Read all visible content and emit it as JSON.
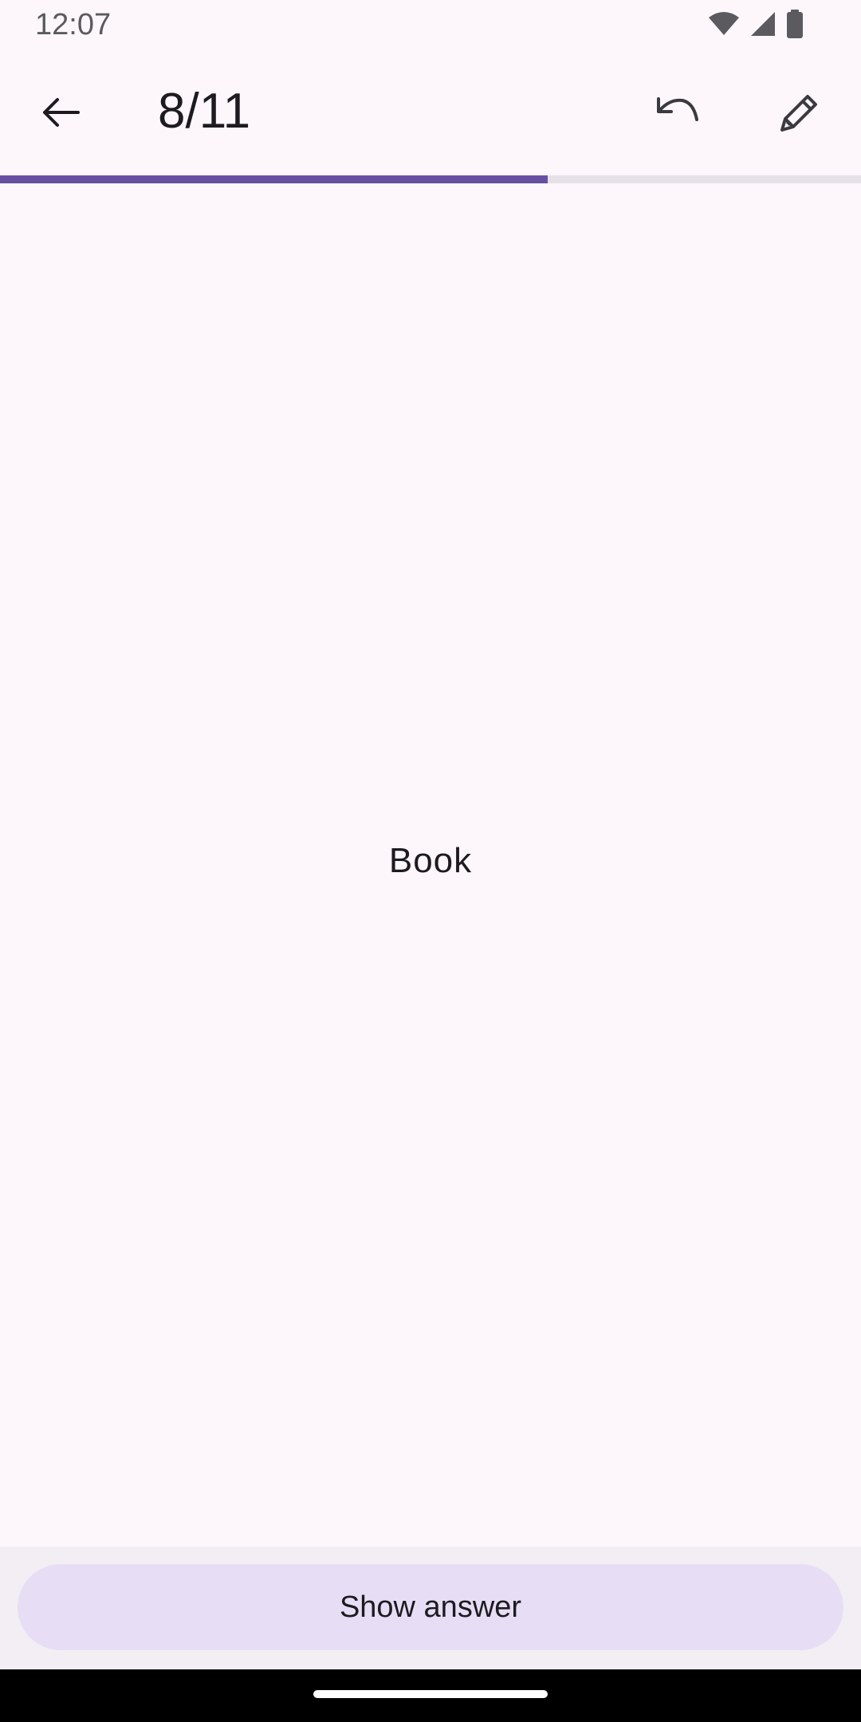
{
  "status_bar": {
    "time": "12:07",
    "icons": [
      "wifi-icon",
      "signal-icon",
      "battery-icon"
    ]
  },
  "app_bar": {
    "counter": "8/11",
    "back_icon": "arrow-back-icon",
    "undo_icon": "undo-icon",
    "edit_icon": "pencil-icon"
  },
  "progress": {
    "current": 8,
    "total": 11,
    "fraction": 0.636
  },
  "card": {
    "front_text": "Book"
  },
  "actions": {
    "show_answer_label": "Show answer"
  },
  "colors": {
    "accent": "#6750A4",
    "background": "#FDF7FC",
    "button": "#E7DEF5"
  }
}
